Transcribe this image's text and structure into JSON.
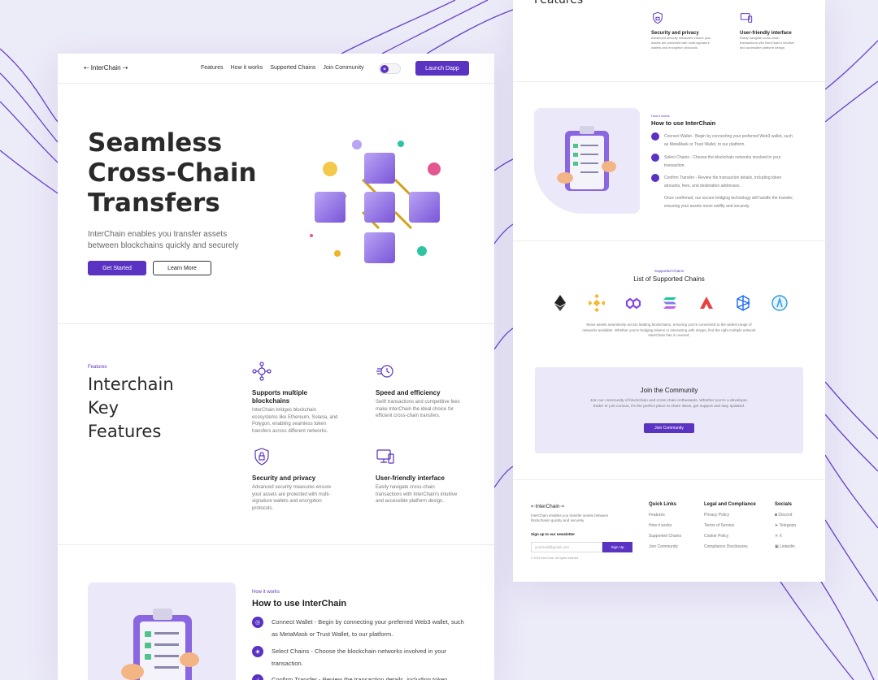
{
  "brand": "InterChain",
  "nav": {
    "links": [
      "Features",
      "How it works",
      "Supported Chains",
      "Join Community"
    ],
    "launch_label": "Launch Dapp"
  },
  "hero": {
    "title_line1": "Seamless",
    "title_line2": "Cross-Chain",
    "title_line3": "Transfers",
    "subtitle_line1": "InterChain enables you transfer assets",
    "subtitle_line2": "between blockchains quickly and securely",
    "primary_label": "Get Started",
    "secondary_label": "Learn More"
  },
  "features": {
    "eyebrow": "Features",
    "heading_line1": "Interchain",
    "heading_line2": "Key",
    "heading_line3": "Features",
    "items": [
      {
        "title": "Supports multiple blockchains",
        "desc": "InterChain bridges blockchain ecosystems like Ethereum, Solana, and Polygon, enabling seamless token transfers across different networks."
      },
      {
        "title": "Speed and efficiency",
        "desc": "Swift transactions and competitive fees make InterChain the ideal choice for efficient cross-chain transfers."
      },
      {
        "title": "Security and privacy",
        "desc": "Advanced security measures ensure your assets are protected with multi-signature wallets and encryption protocols."
      },
      {
        "title": "User-friendly interface",
        "desc": "Easily navigate cross-chain transactions with InterChain's intuitive and accessible platform design."
      }
    ]
  },
  "how": {
    "eyebrow": "How it works",
    "heading": "How to use InterChain",
    "steps": [
      "Connect Wallet - Begin by connecting your preferred Web3 wallet, such as MetaMask or Trust Wallet, to our platform.",
      "Select Chains - Choose the blockchain networks involved in your transaction.",
      "Confirm Transfer - Review the transaction details, including token amounts, fees, and destination addresses."
    ],
    "closing": "Once confirmed, our secure bridging technology will handle the transfer, ensuring your assets move swiftly and securely."
  },
  "right_features_top": [
    {
      "title": "Security and privacy",
      "desc": "Advanced security measures ensure your assets are protected with multi-signature wallets and encryption protocols."
    },
    {
      "title": "User-friendly interface",
      "desc": "Easily navigate cross-chain transactions with InterChain's intuitive and accessible platform design."
    }
  ],
  "right_top_heading": "Features",
  "chains": {
    "eyebrow": "Supported Chains",
    "heading": "List of Supported Chains",
    "names": [
      "Ethereum",
      "BNB Chain",
      "Polygon",
      "Solana",
      "Avalanche",
      "Fantom",
      "Arbitrum"
    ],
    "colors": [
      "#222222",
      "#f3ba2f",
      "#8247e5",
      "#14c8a0",
      "#e84142",
      "#1969ff",
      "#2d9cdb"
    ],
    "desc": "Move assets seamlessly across leading blockchains, ensuring you're connected to the widest range of networks available. Whether you're bridging tokens or interacting with dApps, find the right multiple network InterChain has it covered."
  },
  "community": {
    "heading": "Join the Community",
    "desc": "Join our community of blockchain and cross-chain enthusiasts. Whether you're a developer, trader or just curious, it's the perfect place to share ideas, get support and stay updated.",
    "button": "Join Community"
  },
  "footer": {
    "tagline": "InterChain enables you transfer assets between blockchains quickly and securely",
    "newsletter_label": "Sign up to our newsletter",
    "email_placeholder": "yourmail@gmail.com",
    "signup_label": "Sign Up",
    "copyright": "© 2024 InterChain. All rights reserved.",
    "quick_links_title": "Quick Links",
    "quick_links": [
      "Features",
      "How it works",
      "Supported Chains",
      "Join Community"
    ],
    "legal_title": "Legal and Compliance",
    "legal": [
      "Privacy Policy",
      "Terms of Service",
      "Cookie Policy",
      "Compliance Disclosures"
    ],
    "socials_title": "Socials",
    "socials": [
      "Discord",
      "Telegram",
      "X",
      "Linkedin"
    ]
  },
  "colors": {
    "accent": "#5a33c2",
    "background": "#ecebf8",
    "panel": "#ebe8fa"
  }
}
